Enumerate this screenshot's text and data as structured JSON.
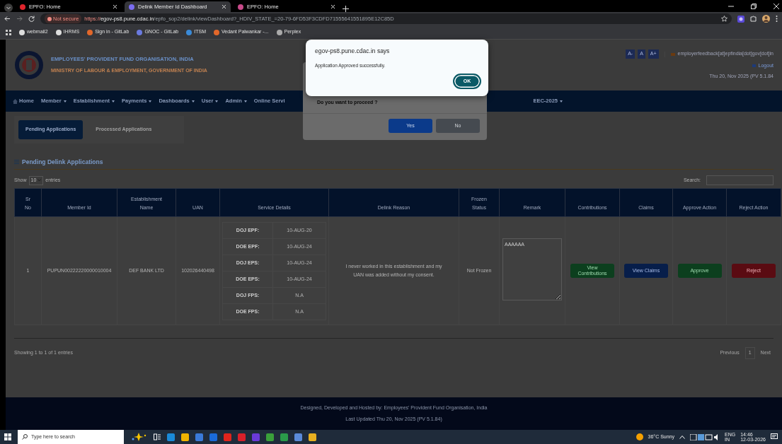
{
  "browser": {
    "tabs": [
      {
        "title": "EPFO: Home",
        "selected": false
      },
      {
        "title": "Delink Member Id Dashboard",
        "selected": true
      },
      {
        "title": "EPFO: Home",
        "selected": false
      }
    ],
    "security": "Not secure",
    "url_scheme": "https://",
    "url_host": "egov-ps8.pune.cdac.in",
    "url_path": "/epfo_sop2/delink/viewDashboard?_HDIV_STATE_=20-79-6FD53F3CDFD71555641551895E12C85D",
    "bookmarks": [
      "webmail2",
      "IHRMS",
      "Sign in - GitLab",
      "GNOC - GitLab",
      "ITSM",
      "Vedant Palwankar -...",
      "Perplex"
    ]
  },
  "header": {
    "org": "EMPLOYEES' PROVIDENT FUND ORGANISATION, INDIA",
    "ministry": "MINISTRY OF LABOUR & EMPLOYMENT, GOVERNMENT OF INDIA",
    "font_buttons": [
      "A-",
      "A",
      "A+"
    ],
    "email": "employerfeedback[at]epfindia[dot]gov[dot]in",
    "logout": "Logout",
    "date": "Thu 20, Nov 2025 (PV 5.1.84"
  },
  "nav": [
    {
      "label": "Home",
      "dropdown": false
    },
    {
      "label": "Member",
      "dropdown": true
    },
    {
      "label": "Establishment",
      "dropdown": true
    },
    {
      "label": "Payments",
      "dropdown": true
    },
    {
      "label": "Dashboards",
      "dropdown": true
    },
    {
      "label": "User",
      "dropdown": true
    },
    {
      "label": "Admin",
      "dropdown": true
    },
    {
      "label": "Online Servi",
      "dropdown": false
    },
    {
      "label": "EEC-2025",
      "dropdown": true
    }
  ],
  "page_tabs": [
    {
      "label": "Pending Applications",
      "selected": true
    },
    {
      "label": "Processed Applications",
      "selected": false
    }
  ],
  "section_title": "Pending Delink Applications",
  "length_menu": {
    "prefix": "Show",
    "value": "10",
    "suffix": "entries"
  },
  "search_label": "Search:",
  "table": {
    "columns": [
      [
        "Sr",
        "No"
      ],
      [
        "Member Id"
      ],
      [
        "Establishment",
        "Name"
      ],
      [
        "UAN"
      ],
      [
        "Service Details"
      ],
      [
        "Delink Reason"
      ],
      [
        "Frozen",
        "Status"
      ],
      [
        "Remark"
      ],
      [
        "Contributions"
      ],
      [
        "Claims"
      ],
      [
        "Approve Action"
      ],
      [
        "Reject Action"
      ]
    ],
    "rows": [
      {
        "sr": "1",
        "member_id": "PUPUN00222220000010004",
        "establishment": "DEF BANK LTD",
        "uan": "102026440498",
        "service_details": [
          {
            "label": "DOJ EPF:",
            "value": "10-AUG-20"
          },
          {
            "label": "DOE EPF:",
            "value": "10-AUG-24"
          },
          {
            "label": "DOJ EPS:",
            "value": "10-AUG-24"
          },
          {
            "label": "DOE EPS:",
            "value": "10-AUG-24"
          },
          {
            "label": "DOJ FPS:",
            "value": "N.A"
          },
          {
            "label": "DOE FPS:",
            "value": "N.A"
          }
        ],
        "delink_reason": "I never worked in this establishment and my UAN was added without my consent.",
        "frozen_status": "Not Frozen",
        "remark": "AAAAAA",
        "actions": [
          {
            "label": "View Contributions",
            "kind": "success"
          },
          {
            "label": "View Claims",
            "kind": "primary"
          },
          {
            "label": "Approve",
            "kind": "success"
          },
          {
            "label": "Reject",
            "kind": "danger"
          }
        ]
      }
    ]
  },
  "info": "Showing 1 to 1 of 1 entries",
  "pagination": [
    {
      "label": "Previous",
      "selected": false
    },
    {
      "label": "1",
      "selected": true
    },
    {
      "label": "Next",
      "selected": false
    }
  ],
  "footer": [
    "Designed, Developed and Hosted by: Employees' Provident Fund Organisation, India",
    "Last Updated Thu 20, Nov 2025 (PV 5.1.84)"
  ],
  "confirm_dialog": {
    "message": "Do you want to proceed ?",
    "buttons": [
      {
        "label": "Yes",
        "kind": "primary"
      },
      {
        "label": "No",
        "kind": "secondary"
      }
    ]
  },
  "alert": {
    "origin": "egov-ps8.pune.cdac.in says",
    "message": "Application Approved successfully.",
    "button": "OK"
  },
  "taskbar": {
    "search_placeholder": "Type here to search",
    "weather": "36°C  Sunny",
    "language": "ENG",
    "region": "IN",
    "time": "14:46",
    "date": "12-03-2026"
  }
}
